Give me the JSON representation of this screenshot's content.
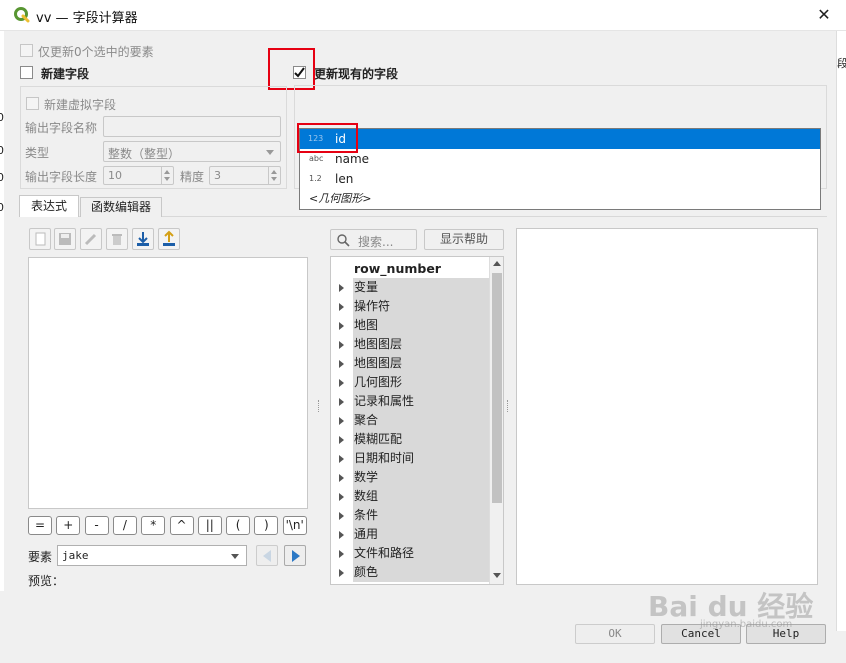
{
  "window": {
    "title": "vv — 字段计算器"
  },
  "top": {
    "only_selected_label": "仅更新0个选中的要素",
    "new_field_label": "新建字段",
    "update_existing_label": "更新现有的字段"
  },
  "new_field": {
    "virtual_label": "新建虚拟字段",
    "output_name_label": "输出字段名称",
    "output_name_value": "",
    "type_label": "类型",
    "type_value": "整数（整型）",
    "length_label": "输出字段长度",
    "length_value": "10",
    "precision_label": "精度",
    "precision_value": "3"
  },
  "field_list": {
    "items": [
      {
        "type": "123",
        "name": "id"
      },
      {
        "type": "abc",
        "name": "name"
      },
      {
        "type": "1.2",
        "name": "len"
      },
      {
        "type": "",
        "name": "<几何图形>"
      }
    ]
  },
  "tabs": [
    "表达式",
    "函数编辑器"
  ],
  "operators": [
    "=",
    "+",
    "-",
    "/",
    "*",
    "^",
    "||",
    "(",
    ")",
    "'\\n'"
  ],
  "feature": {
    "label": "要素",
    "value": "jake"
  },
  "preview": {
    "label": "预览："
  },
  "search": {
    "placeholder": "搜索...",
    "help_label": "显示帮助"
  },
  "tree": {
    "first": "row_number",
    "groups": [
      "变量",
      "操作符",
      "地图",
      "地图图层",
      "地图图层",
      "几何图形",
      "记录和属性",
      "聚合",
      "模糊匹配",
      "日期和时间",
      "数学",
      "数组",
      "条件",
      "通用",
      "文件和路径",
      "颜色"
    ]
  },
  "buttons": {
    "ok": "OK",
    "cancel": "Cancel",
    "help": "Help"
  },
  "background": {
    "digits": [
      "0",
      "0",
      "0",
      "0"
    ],
    "fragment": "段"
  },
  "watermark": {
    "text": "Bai du 经验",
    "sub": "jingyan.baidu.com"
  },
  "colors": {
    "accent": "#0078d7",
    "highlight": "#e60012",
    "qgis_green": "#589632"
  }
}
